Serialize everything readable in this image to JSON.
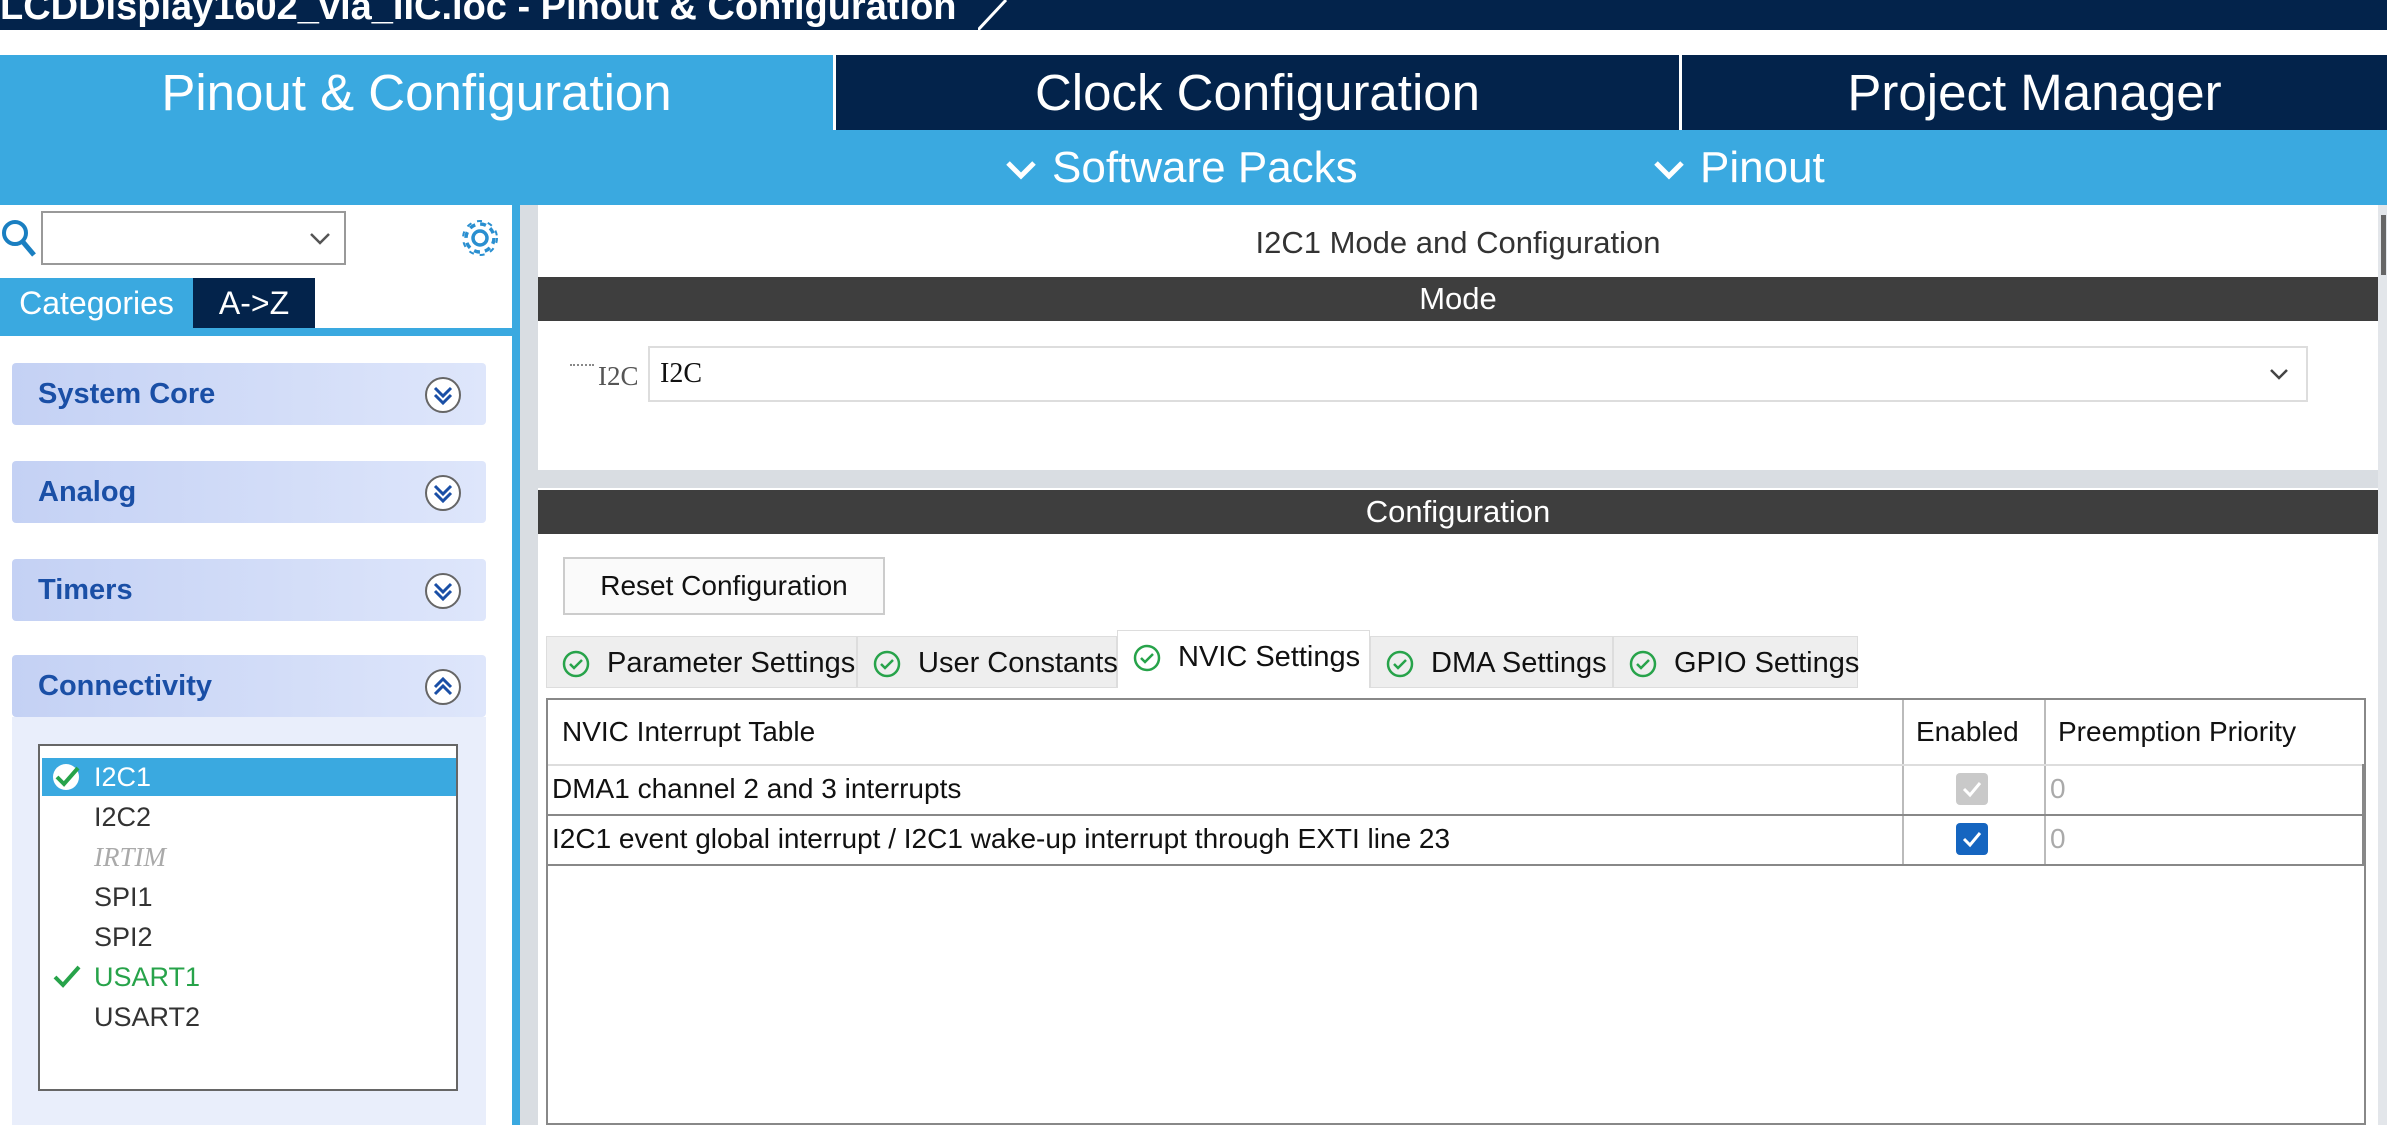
{
  "window": {
    "title": "LCDDisplay1602_via_IIC.ioc - Pinout & Configuration"
  },
  "main_tabs": [
    {
      "label": "Pinout & Configuration",
      "active": true
    },
    {
      "label": "Clock Configuration",
      "active": false
    },
    {
      "label": "Project Manager",
      "active": false
    }
  ],
  "sub_tabs": [
    {
      "label": "Software Packs",
      "icon": "chevron-down-icon"
    },
    {
      "label": "Pinout",
      "icon": "chevron-down-icon"
    }
  ],
  "sidebar": {
    "search": {
      "value": "",
      "icon": "search-icon"
    },
    "settings_icon": "gear-icon",
    "view_tabs": [
      {
        "label": "Categories",
        "active": true
      },
      {
        "label": "A->Z",
        "active": false
      }
    ],
    "sections": [
      {
        "label": "System Core",
        "expanded": false
      },
      {
        "label": "Analog",
        "expanded": false
      },
      {
        "label": "Timers",
        "expanded": false
      },
      {
        "label": "Connectivity",
        "expanded": true
      }
    ],
    "connectivity_items": [
      {
        "label": "I2C1",
        "state": "selected-ok"
      },
      {
        "label": "I2C2",
        "state": "normal"
      },
      {
        "label": "IRTIM",
        "state": "disabled"
      },
      {
        "label": "SPI1",
        "state": "normal"
      },
      {
        "label": "SPI2",
        "state": "normal"
      },
      {
        "label": "USART1",
        "state": "ok"
      },
      {
        "label": "USART2",
        "state": "normal"
      }
    ]
  },
  "panel": {
    "title": "I2C1 Mode and Configuration",
    "mode_header": "Mode",
    "mode_field": {
      "label": "I2C",
      "value": "I2C"
    },
    "configuration_header": "Configuration",
    "reset_button": "Reset Configuration",
    "config_tabs": [
      {
        "label": "Parameter Settings",
        "active": false
      },
      {
        "label": "User Constants",
        "active": false
      },
      {
        "label": "NVIC Settings",
        "active": true
      },
      {
        "label": "DMA Settings",
        "active": false
      },
      {
        "label": "GPIO Settings",
        "active": false
      }
    ],
    "nvic_table": {
      "headers": [
        "NVIC Interrupt Table",
        "Enabled",
        "Preemption Priority"
      ],
      "rows": [
        {
          "name": "DMA1 channel 2 and 3 interrupts",
          "enabled": true,
          "enabled_editable": false,
          "priority": "0"
        },
        {
          "name": "I2C1 event global interrupt / I2C1 wake-up interrupt through EXTI line 23",
          "enabled": true,
          "enabled_editable": true,
          "priority": "0"
        }
      ]
    }
  },
  "colors": {
    "brand_dark": "#03234b",
    "brand_light": "#3aa9e0",
    "header_bar": "#3e3e3e",
    "ok_green": "#27a34a",
    "checkbox_blue": "#1565c0"
  }
}
